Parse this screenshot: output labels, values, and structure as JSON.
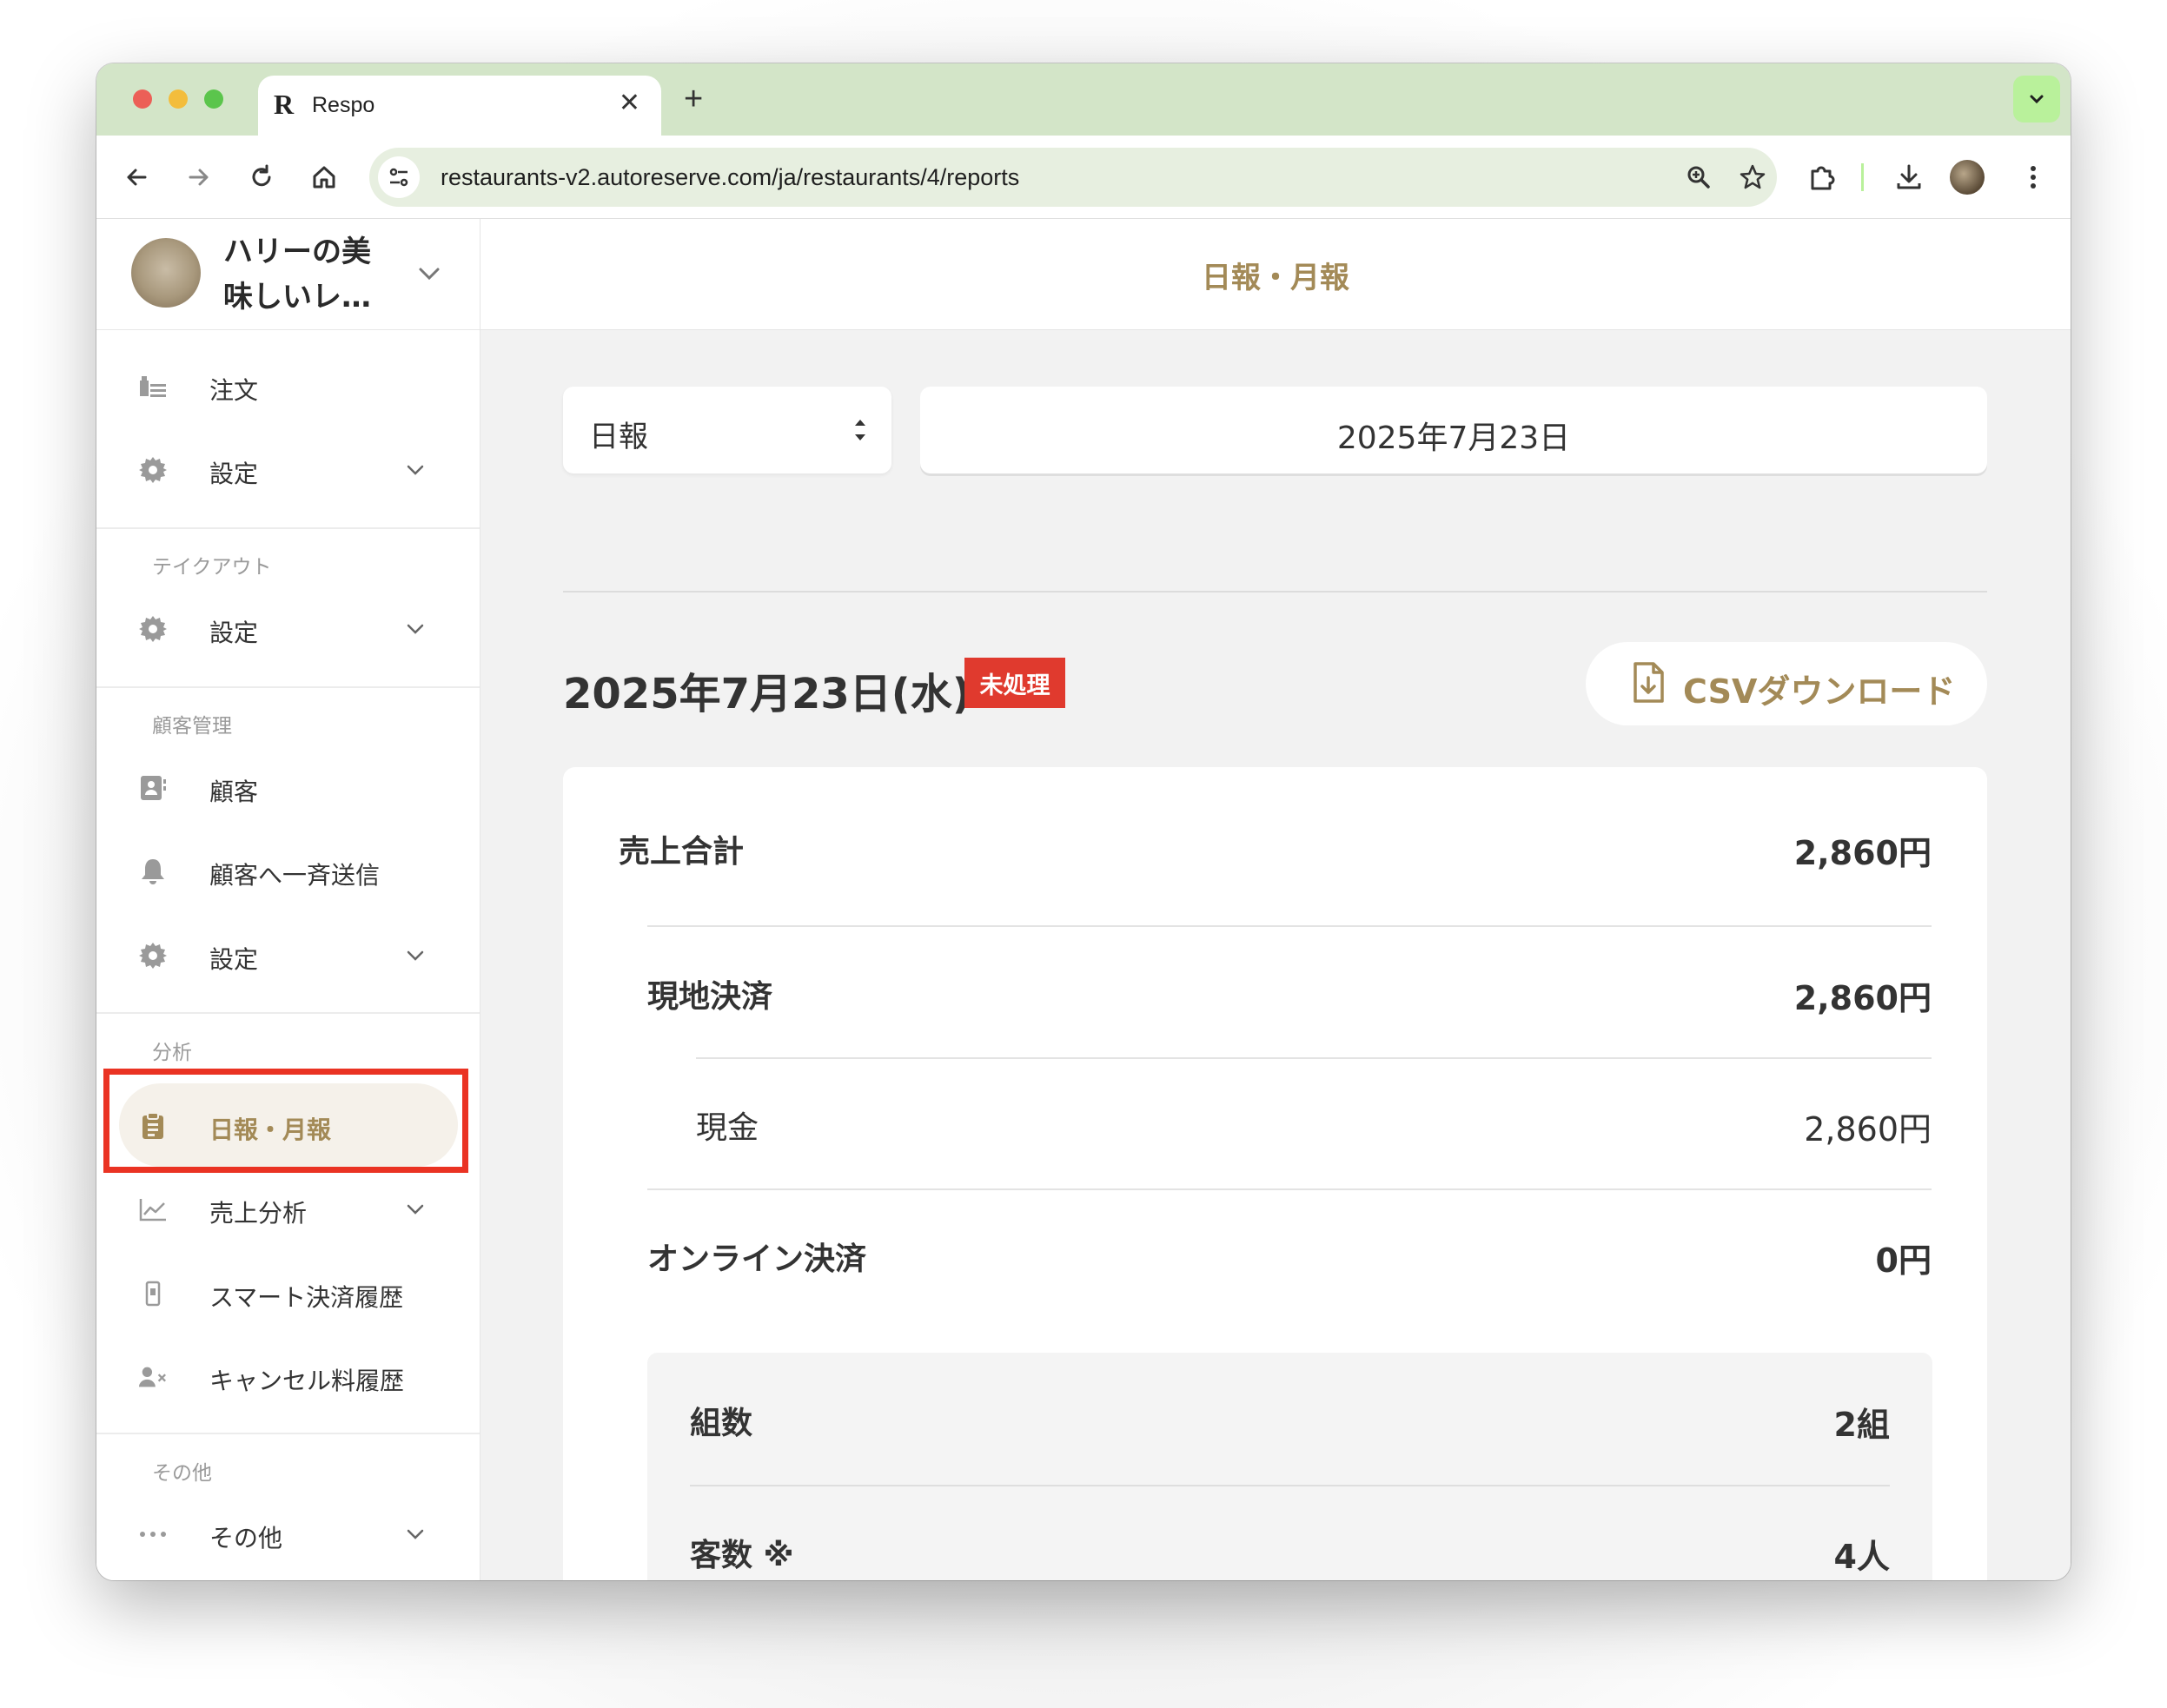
{
  "browser": {
    "tab_title": "Respo",
    "tab_logo": "R",
    "url": "restaurants-v2.autoreserve.com/ja/restaurants/4/reports"
  },
  "sidebar": {
    "restaurant_name": "ハリーの美\n味しいレ…",
    "items": [
      {
        "label": "注文",
        "icon": "receipt-icon"
      },
      {
        "label": "設定",
        "icon": "gear-icon"
      },
      {
        "section": "テイクアウト"
      },
      {
        "label": "設定",
        "icon": "gear-icon"
      },
      {
        "section": "顧客管理"
      },
      {
        "label": "顧客",
        "icon": "contact-card-icon"
      },
      {
        "label": "顧客へ一斉送信",
        "icon": "bell-icon"
      },
      {
        "label": "設定",
        "icon": "gear-icon"
      },
      {
        "section": "分析"
      },
      {
        "label": "日報・月報",
        "icon": "clipboard-icon",
        "active": true
      },
      {
        "label": "売上分析",
        "icon": "chart-line-icon"
      },
      {
        "label": "スマート決済履歴",
        "icon": "phone-icon"
      },
      {
        "label": "キャンセル料履歴",
        "icon": "user-cancel-icon"
      },
      {
        "section": "その他"
      },
      {
        "label": "その他",
        "icon": "more-dots-icon"
      }
    ]
  },
  "main": {
    "title": "日報・月報",
    "period_select": "日報",
    "date_value": "2025年7月23日",
    "report_date": "2025年7月23日(水)",
    "status_badge": "未処理",
    "csv_button": "CSVダウンロード",
    "rows": {
      "total_sales_label": "売上合計",
      "total_sales_value": "2,860円",
      "onsite_label": "現地決済",
      "onsite_value": "2,860円",
      "cash_label": "現金",
      "cash_value": "2,860円",
      "online_label": "オンライン決済",
      "online_value": "0円",
      "groups_label": "組数",
      "groups_value": "2組",
      "guests_label": "客数 ※",
      "guests_value": "4人"
    }
  },
  "colors": {
    "accent": "#a38a57",
    "badge_red": "#e03a2e",
    "highlight_red": "#ea3323",
    "tabstrip": "#d3e5c8"
  }
}
